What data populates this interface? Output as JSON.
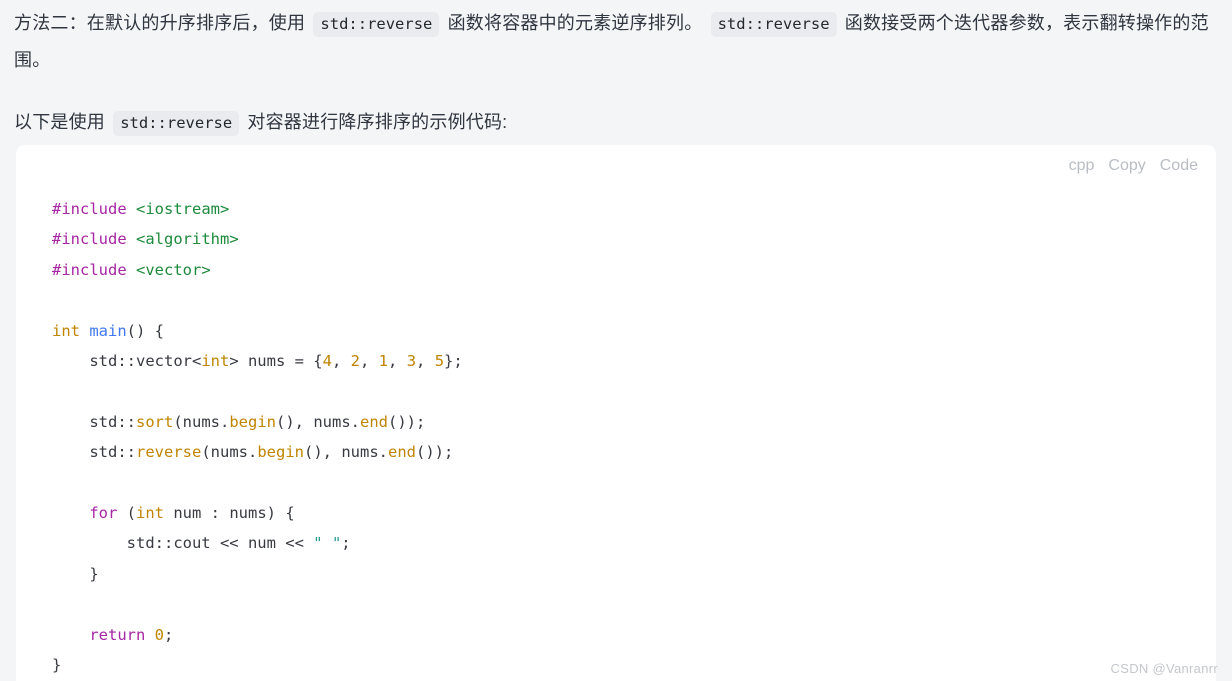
{
  "page": {
    "background_color": "#f4f5f7",
    "text_color": "#2f3640"
  },
  "paragraphs": [
    {
      "id": "method-two",
      "segments": [
        {
          "type": "text",
          "value": "方法二：在默认的升序排序后，使用 "
        },
        {
          "type": "code",
          "value": "std::reverse"
        },
        {
          "type": "text",
          "value": " 函数将容器中的元素逆序排列。 "
        },
        {
          "type": "code",
          "value": "std::reverse"
        },
        {
          "type": "text",
          "value": " 函数接受两个迭代器参数，表示翻转操作的范围。"
        }
      ]
    },
    {
      "id": "example-intro",
      "segments": [
        {
          "type": "text",
          "value": "以下是使用 "
        },
        {
          "type": "code",
          "value": "std::reverse"
        },
        {
          "type": "text",
          "value": " 对容器进行降序排序的示例代码:"
        }
      ]
    }
  ],
  "code_block": {
    "language_label": "cpp",
    "copy_label": "Copy",
    "code_label": "Code",
    "background_color": "#ffffff",
    "lines": [
      "#include <iostream>",
      "#include <algorithm>",
      "#include <vector>",
      "",
      "int main() {",
      "    std::vector<int> nums = {4, 2, 1, 3, 5};",
      "",
      "    std::sort(nums.begin(), nums.end());",
      "    std::reverse(nums.begin(), nums.end());",
      "",
      "    for (int num : nums) {",
      "        std::cout << num << \" \";",
      "    }",
      "",
      "    return 0;",
      "}"
    ],
    "syntax_colors": {
      "preprocessor": "#a626a4",
      "header": "#1d8a3c",
      "keyword": "#a626a4",
      "type": "#c18401",
      "function": "#4078f2",
      "call": "#c18401",
      "number": "#c18401",
      "string": "#2a9d8f",
      "plain": "#383a42"
    }
  },
  "watermark": {
    "text": "CSDN @Vanranrr"
  }
}
